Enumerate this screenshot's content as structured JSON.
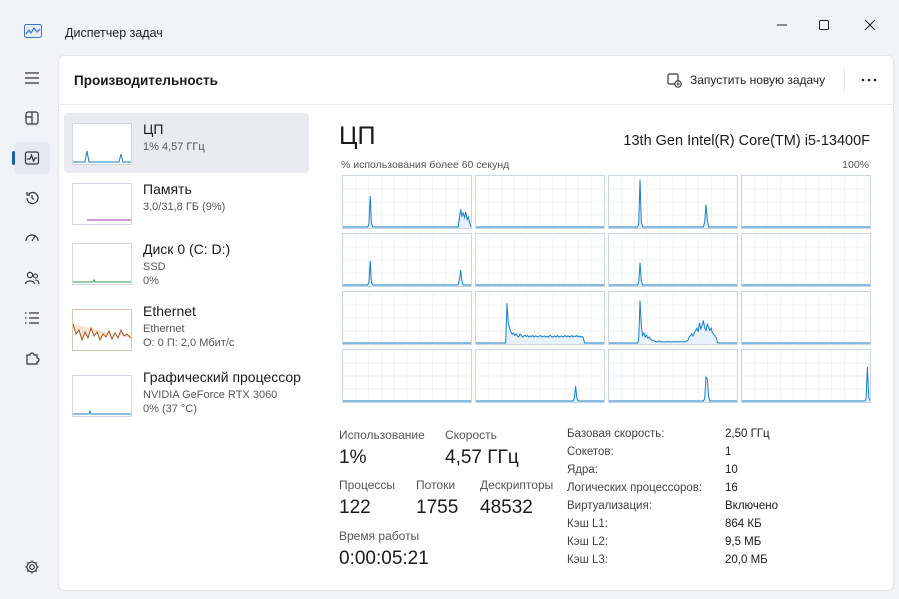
{
  "window": {
    "title": "Диспетчер задач"
  },
  "header": {
    "title": "Производительность",
    "run_task_label": "Запустить новую задачу"
  },
  "colors": {
    "accent": "#1f5fa8",
    "cpu_line": "#1780c9",
    "memory_line": "#8e3aa3",
    "ethernet_line": "#a7541d"
  },
  "devices": [
    {
      "name": "ЦП",
      "line1": "1% 4,57 ГГц",
      "line2": ""
    },
    {
      "name": "Память",
      "line1": "3,0/31,8 ГБ (9%)",
      "line2": ""
    },
    {
      "name": "Диск 0 (C: D:)",
      "line1": "SSD",
      "line2": "0%"
    },
    {
      "name": "Ethernet",
      "line1": "Ethernet",
      "line2": "О: 0 П: 2,0 Мбит/с"
    },
    {
      "name": "Графический процессор",
      "line1": "NVIDIA GeForce RTX 3060",
      "line2": "0% (37 °C)"
    }
  ],
  "cpu": {
    "title": "ЦП",
    "model": "13th Gen Intel(R) Core(TM) i5-13400F",
    "axis_label": "% использования более 60 секунд",
    "axis_max": "100%"
  },
  "stats": {
    "usage_label": "Использование",
    "usage_value": "1%",
    "speed_label": "Скорость",
    "speed_value": "4,57 ГГц",
    "processes_label": "Процессы",
    "processes_value": "122",
    "threads_label": "Потоки",
    "threads_value": "1755",
    "handles_label": "Дескрипторы",
    "handles_value": "48532",
    "uptime_label": "Время работы",
    "uptime_value": "0:00:05:21"
  },
  "specs": [
    {
      "label": "Базовая скорость:",
      "value": "2,50 ГГц"
    },
    {
      "label": "Сокетов:",
      "value": "1"
    },
    {
      "label": "Ядра:",
      "value": "10"
    },
    {
      "label": "Логических процессоров:",
      "value": "16"
    },
    {
      "label": "Виртуализация:",
      "value": "Включено"
    },
    {
      "label": "Кэш L1:",
      "value": "864 КБ"
    },
    {
      "label": "Кэш L2:",
      "value": "9,5 МБ"
    },
    {
      "label": "Кэш L3:",
      "value": "20,0 МБ"
    }
  ],
  "core_graphs": [
    [
      0,
      0,
      0,
      0,
      0,
      0,
      0,
      0,
      0,
      0,
      0,
      0,
      0,
      0,
      0,
      0,
      0,
      0,
      0,
      0,
      5,
      62,
      8,
      0,
      0,
      0,
      0,
      0,
      0,
      0,
      0,
      0,
      0,
      0,
      0,
      0,
      0,
      0,
      0,
      0,
      0,
      0,
      0,
      0,
      0,
      0,
      0,
      0,
      0,
      0,
      0,
      0,
      0,
      0,
      0,
      0,
      0,
      0,
      0,
      0,
      0,
      0,
      0,
      0,
      0,
      0,
      0,
      0,
      0,
      0,
      0,
      0,
      0,
      0,
      0,
      0,
      0,
      0,
      0,
      0,
      0,
      0,
      0,
      0,
      0,
      0,
      0,
      0,
      0,
      0,
      18,
      35,
      22,
      28,
      19,
      30,
      15,
      20,
      8,
      0
    ],
    [
      0,
      0,
      0,
      0,
      0,
      0,
      0,
      0,
      0,
      0,
      0,
      0,
      0,
      0,
      0,
      0,
      0,
      0,
      0,
      0,
      0,
      0,
      0,
      0,
      0,
      0,
      0,
      0,
      0,
      0,
      0,
      0,
      0,
      0,
      0,
      0,
      0,
      0,
      0,
      0,
      0,
      0,
      0,
      0,
      0,
      0,
      0,
      0,
      0,
      0,
      0,
      0,
      0,
      0,
      0,
      0,
      0,
      0,
      0,
      0,
      0,
      0,
      0,
      0,
      0,
      0,
      0,
      0,
      0,
      0,
      0,
      0,
      0,
      0,
      0,
      0,
      0,
      0,
      0,
      0,
      0,
      0,
      0,
      0,
      0,
      0,
      0,
      0,
      0,
      0,
      0,
      0,
      0,
      0,
      0,
      0,
      0,
      0,
      0,
      0
    ],
    [
      0,
      0,
      0,
      0,
      0,
      0,
      0,
      0,
      0,
      0,
      0,
      0,
      0,
      0,
      0,
      0,
      0,
      0,
      0,
      0,
      0,
      0,
      0,
      5,
      95,
      10,
      0,
      0,
      0,
      0,
      0,
      0,
      0,
      0,
      0,
      0,
      0,
      0,
      0,
      0,
      0,
      0,
      0,
      0,
      0,
      0,
      0,
      0,
      0,
      0,
      0,
      0,
      0,
      0,
      0,
      0,
      0,
      0,
      0,
      0,
      0,
      0,
      0,
      0,
      0,
      0,
      0,
      0,
      0,
      0,
      0,
      0,
      0,
      0,
      10,
      45,
      15,
      0,
      0,
      0,
      0,
      0,
      0,
      0,
      0,
      0,
      0,
      0,
      0,
      0,
      0,
      0,
      0,
      0,
      0,
      0,
      0,
      0,
      0,
      0
    ],
    [
      0,
      0,
      0,
      0,
      0,
      0,
      0,
      0,
      0,
      0,
      0,
      0,
      0,
      0,
      0,
      0,
      0,
      0,
      0,
      0,
      0,
      0,
      0,
      0,
      0,
      0,
      0,
      0,
      0,
      0,
      0,
      0,
      0,
      0,
      0,
      0,
      0,
      0,
      0,
      0,
      0,
      0,
      0,
      0,
      0,
      0,
      0,
      0,
      0,
      0,
      0,
      0,
      0,
      0,
      0,
      0,
      0,
      0,
      0,
      0,
      0,
      0,
      0,
      0,
      0,
      0,
      0,
      0,
      0,
      0,
      0,
      0,
      0,
      0,
      0,
      0,
      0,
      0,
      0,
      0,
      0,
      0,
      0,
      0,
      0,
      0,
      0,
      0,
      0,
      0,
      0,
      0,
      0,
      0,
      0,
      0,
      0,
      0,
      0,
      0
    ],
    [
      0,
      0,
      0,
      0,
      0,
      0,
      0,
      0,
      0,
      0,
      0,
      0,
      0,
      0,
      0,
      0,
      0,
      0,
      0,
      0,
      5,
      48,
      6,
      0,
      0,
      0,
      0,
      0,
      0,
      0,
      0,
      0,
      0,
      0,
      0,
      0,
      0,
      0,
      0,
      0,
      0,
      0,
      0,
      0,
      0,
      0,
      0,
      0,
      0,
      0,
      0,
      0,
      0,
      0,
      0,
      0,
      0,
      0,
      0,
      0,
      0,
      0,
      0,
      0,
      0,
      0,
      0,
      0,
      0,
      0,
      0,
      0,
      0,
      0,
      0,
      0,
      0,
      0,
      0,
      0,
      0,
      0,
      0,
      0,
      0,
      0,
      0,
      0,
      0,
      0,
      10,
      30,
      8,
      0,
      0,
      0,
      0,
      0,
      0,
      0
    ],
    [
      0,
      0,
      0,
      0,
      0,
      0,
      0,
      0,
      0,
      0,
      0,
      0,
      0,
      0,
      0,
      0,
      0,
      0,
      0,
      0,
      0,
      0,
      0,
      0,
      0,
      0,
      0,
      0,
      0,
      0,
      0,
      0,
      0,
      0,
      0,
      0,
      0,
      0,
      0,
      0,
      0,
      0,
      0,
      0,
      0,
      0,
      0,
      0,
      0,
      0,
      0,
      0,
      0,
      0,
      0,
      0,
      0,
      0,
      0,
      0,
      0,
      0,
      0,
      0,
      0,
      0,
      0,
      0,
      0,
      0,
      0,
      0,
      0,
      0,
      0,
      0,
      0,
      0,
      0,
      0,
      0,
      0,
      0,
      0,
      0,
      0,
      0,
      0,
      0,
      0,
      0,
      0,
      0,
      0,
      0,
      0,
      0,
      0,
      0,
      0
    ],
    [
      0,
      0,
      0,
      0,
      0,
      0,
      0,
      0,
      0,
      0,
      0,
      0,
      0,
      0,
      0,
      0,
      0,
      0,
      0,
      0,
      0,
      0,
      0,
      5,
      45,
      8,
      0,
      0,
      0,
      0,
      0,
      0,
      0,
      0,
      0,
      0,
      0,
      0,
      0,
      0,
      0,
      0,
      0,
      0,
      0,
      0,
      0,
      0,
      0,
      0,
      0,
      0,
      0,
      0,
      0,
      0,
      0,
      0,
      0,
      0,
      0,
      0,
      0,
      0,
      0,
      0,
      0,
      0,
      0,
      0,
      0,
      0,
      0,
      0,
      0,
      0,
      0,
      0,
      0,
      0,
      0,
      0,
      0,
      0,
      0,
      0,
      0,
      0,
      0,
      0,
      0,
      0,
      0,
      0,
      0,
      0,
      0,
      0,
      0,
      0
    ],
    [
      0,
      0,
      0,
      0,
      0,
      0,
      0,
      0,
      0,
      0,
      0,
      0,
      0,
      0,
      0,
      0,
      0,
      0,
      0,
      0,
      0,
      0,
      0,
      0,
      0,
      0,
      0,
      0,
      0,
      0,
      0,
      0,
      0,
      0,
      0,
      0,
      0,
      0,
      0,
      0,
      0,
      0,
      0,
      0,
      0,
      0,
      0,
      0,
      0,
      0,
      0,
      0,
      0,
      0,
      0,
      0,
      0,
      0,
      0,
      0,
      0,
      0,
      0,
      0,
      0,
      0,
      0,
      0,
      0,
      0,
      0,
      0,
      0,
      0,
      0,
      0,
      0,
      0,
      0,
      0,
      0,
      0,
      0,
      0,
      0,
      0,
      0,
      0,
      0,
      0,
      0,
      0,
      0,
      0,
      0,
      0,
      0,
      0,
      0,
      0
    ],
    [
      0,
      0,
      0,
      0,
      0,
      0,
      0,
      0,
      0,
      0,
      0,
      0,
      0,
      0,
      0,
      0,
      0,
      0,
      0,
      0,
      0,
      0,
      0,
      0,
      0,
      0,
      0,
      0,
      0,
      0,
      0,
      0,
      0,
      0,
      0,
      0,
      0,
      0,
      0,
      0,
      0,
      0,
      0,
      0,
      0,
      0,
      0,
      0,
      0,
      0,
      0,
      0,
      0,
      0,
      0,
      0,
      0,
      0,
      0,
      0,
      0,
      0,
      0,
      0,
      0,
      0,
      0,
      0,
      0,
      0,
      0,
      0,
      0,
      0,
      0,
      0,
      0,
      0,
      0,
      0,
      0,
      0,
      0,
      0,
      0,
      0,
      0,
      0,
      0,
      0,
      0,
      0,
      0,
      0,
      0,
      0,
      0,
      0,
      0,
      0
    ],
    [
      0,
      0,
      0,
      0,
      0,
      0,
      0,
      0,
      0,
      0,
      0,
      0,
      0,
      0,
      0,
      0,
      0,
      0,
      0,
      0,
      0,
      0,
      0,
      0,
      80,
      40,
      30,
      22,
      18,
      20,
      15,
      18,
      14,
      12,
      18,
      15,
      12,
      14,
      16,
      13,
      15,
      12,
      14,
      13,
      15,
      12,
      14,
      13,
      12,
      14,
      15,
      12,
      13,
      14,
      12,
      13,
      12,
      15,
      14,
      12,
      13,
      14,
      12,
      15,
      12,
      13,
      14,
      12,
      13,
      15,
      12,
      14,
      13,
      12,
      15,
      12,
      14,
      13,
      15,
      12,
      14,
      12,
      13,
      10,
      0,
      0,
      0,
      0,
      0,
      0,
      0,
      0,
      0,
      0,
      0,
      0,
      0,
      0,
      0,
      0
    ],
    [
      0,
      0,
      0,
      0,
      0,
      0,
      0,
      0,
      0,
      0,
      0,
      0,
      0,
      0,
      0,
      0,
      0,
      0,
      0,
      0,
      0,
      0,
      0,
      5,
      85,
      35,
      15,
      20,
      12,
      16,
      10,
      12,
      8,
      6,
      5,
      4,
      3,
      2,
      3,
      4,
      2,
      3,
      2,
      2,
      3,
      2,
      3,
      2,
      2,
      3,
      2,
      3,
      2,
      3,
      2,
      3,
      2,
      3,
      2,
      3,
      4,
      5,
      12,
      15,
      18,
      14,
      20,
      25,
      30,
      22,
      40,
      28,
      35,
      45,
      30,
      25,
      38,
      32,
      25,
      30,
      20,
      18,
      14,
      10,
      0,
      0,
      0,
      0,
      0,
      0,
      0,
      0,
      0,
      0,
      0,
      0,
      0,
      0,
      0,
      0
    ],
    [
      0,
      0,
      0,
      0,
      0,
      0,
      0,
      0,
      0,
      0,
      0,
      0,
      0,
      0,
      0,
      0,
      0,
      0,
      0,
      0,
      0,
      0,
      0,
      0,
      0,
      0,
      0,
      0,
      0,
      0,
      0,
      0,
      0,
      0,
      0,
      0,
      0,
      0,
      0,
      0,
      0,
      0,
      0,
      0,
      0,
      0,
      0,
      0,
      0,
      0,
      0,
      0,
      0,
      0,
      0,
      0,
      0,
      0,
      0,
      0,
      0,
      0,
      0,
      0,
      0,
      0,
      0,
      0,
      0,
      0,
      0,
      0,
      0,
      0,
      0,
      0,
      0,
      0,
      0,
      0,
      0,
      0,
      0,
      0,
      0,
      0,
      0,
      0,
      0,
      0,
      0,
      0,
      0,
      0,
      0,
      0,
      0,
      0,
      0,
      0
    ],
    [
      0,
      0,
      0,
      0,
      0,
      0,
      0,
      0,
      0,
      0,
      0,
      0,
      0,
      0,
      0,
      0,
      0,
      0,
      0,
      0,
      0,
      0,
      0,
      0,
      0,
      0,
      0,
      0,
      0,
      0,
      0,
      0,
      0,
      0,
      0,
      0,
      0,
      0,
      0,
      0,
      0,
      0,
      0,
      0,
      0,
      0,
      0,
      0,
      0,
      0,
      0,
      0,
      0,
      0,
      0,
      0,
      0,
      0,
      0,
      0,
      0,
      0,
      0,
      0,
      0,
      0,
      0,
      0,
      0,
      0,
      0,
      0,
      0,
      0,
      0,
      0,
      0,
      0,
      0,
      0,
      0,
      0,
      0,
      0,
      0,
      0,
      0,
      0,
      0,
      0,
      0,
      0,
      0,
      0,
      0,
      0,
      0,
      0,
      0,
      0
    ],
    [
      0,
      0,
      0,
      0,
      0,
      0,
      0,
      0,
      0,
      0,
      0,
      0,
      0,
      0,
      0,
      0,
      0,
      0,
      0,
      0,
      0,
      0,
      0,
      0,
      0,
      0,
      0,
      0,
      0,
      0,
      0,
      0,
      0,
      0,
      0,
      0,
      0,
      0,
      0,
      0,
      0,
      0,
      0,
      0,
      0,
      0,
      0,
      0,
      0,
      0,
      0,
      0,
      0,
      0,
      0,
      0,
      0,
      0,
      0,
      0,
      0,
      0,
      0,
      0,
      0,
      0,
      0,
      0,
      0,
      0,
      0,
      0,
      0,
      0,
      0,
      0,
      5,
      30,
      6,
      0,
      0,
      0,
      0,
      0,
      0,
      0,
      0,
      0,
      0,
      0,
      0,
      0,
      0,
      0,
      0,
      0,
      0,
      0,
      0,
      0
    ],
    [
      0,
      0,
      0,
      0,
      0,
      0,
      0,
      0,
      0,
      0,
      0,
      0,
      0,
      0,
      0,
      0,
      0,
      0,
      0,
      0,
      0,
      0,
      0,
      0,
      0,
      0,
      0,
      0,
      0,
      0,
      0,
      0,
      0,
      0,
      0,
      0,
      0,
      0,
      0,
      0,
      0,
      0,
      0,
      0,
      0,
      0,
      0,
      0,
      0,
      0,
      0,
      0,
      0,
      0,
      0,
      0,
      0,
      0,
      0,
      0,
      0,
      0,
      0,
      0,
      0,
      0,
      0,
      0,
      0,
      0,
      0,
      0,
      0,
      0,
      5,
      48,
      44,
      10,
      0,
      0,
      0,
      0,
      0,
      0,
      0,
      0,
      0,
      0,
      0,
      0,
      0,
      0,
      0,
      0,
      0,
      0,
      0,
      0,
      0,
      0
    ],
    [
      0,
      0,
      0,
      0,
      0,
      0,
      0,
      0,
      0,
      0,
      0,
      0,
      0,
      0,
      0,
      0,
      0,
      0,
      0,
      0,
      0,
      0,
      0,
      0,
      0,
      0,
      0,
      0,
      0,
      0,
      0,
      0,
      0,
      0,
      0,
      0,
      0,
      0,
      0,
      0,
      0,
      0,
      0,
      0,
      0,
      0,
      0,
      0,
      0,
      0,
      0,
      0,
      0,
      0,
      0,
      0,
      0,
      0,
      0,
      0,
      0,
      0,
      0,
      0,
      0,
      0,
      0,
      0,
      0,
      0,
      0,
      0,
      0,
      0,
      0,
      0,
      0,
      0,
      0,
      0,
      0,
      0,
      0,
      0,
      0,
      0,
      0,
      0,
      0,
      0,
      0,
      0,
      0,
      0,
      0,
      0,
      5,
      68,
      8,
      0
    ]
  ]
}
